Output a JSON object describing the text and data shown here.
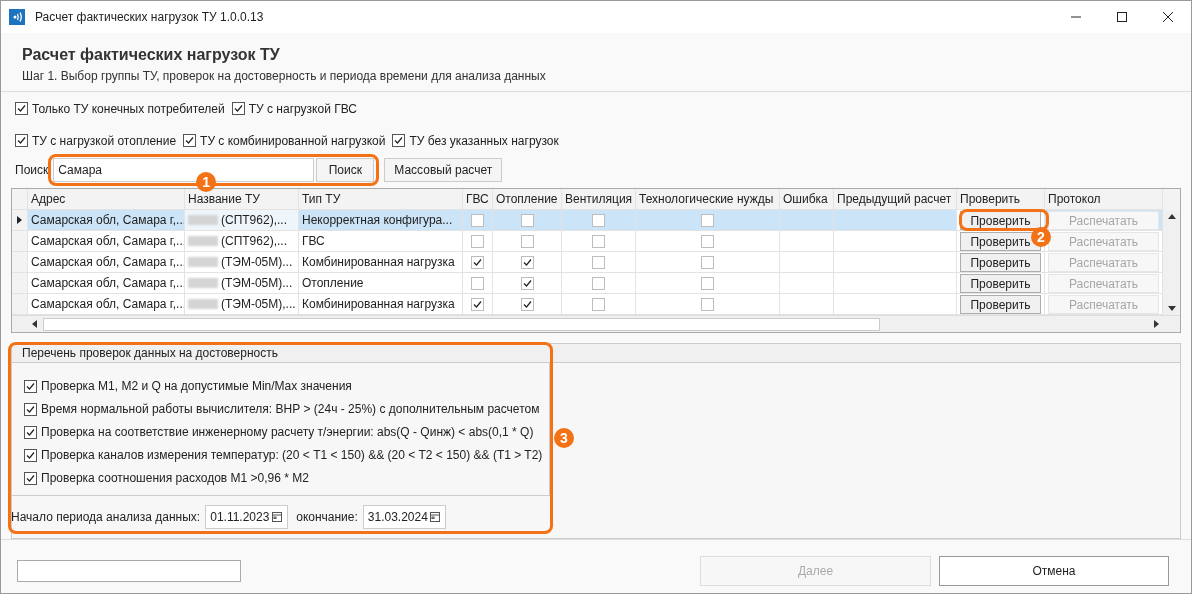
{
  "window": {
    "title": "Расчет фактических нагрузок ТУ 1.0.0.13"
  },
  "header": {
    "title": "Расчет фактических нагрузок ТУ",
    "subtitle": "Шаг 1. Выбор группы ТУ, проверок на достоверность и периода времени для анализа данных"
  },
  "filter_rows": [
    [
      {
        "label": "Только ТУ конечных потребителей",
        "checked": true
      },
      {
        "label": "ТУ с нагрузкой ГВС",
        "checked": true
      }
    ],
    [
      {
        "label": "ТУ с нагрузкой отопление",
        "checked": true
      },
      {
        "label": "ТУ с комбинированной нагрузкой",
        "checked": true
      },
      {
        "label": "ТУ без указанных нагрузок",
        "checked": true
      }
    ]
  ],
  "search": {
    "label": "Поиск",
    "value": "Самара",
    "button": "Поиск",
    "mass_button": "Массовый расчет",
    "callout": "1"
  },
  "table": {
    "columns": [
      "Адрес",
      "Название ТУ",
      "Тип ТУ",
      "ГВС",
      "Отопление",
      "Вентиляция",
      "Технологические нужды",
      "Ошибка",
      "Предыдущий расчет",
      "Проверить",
      "Протокол"
    ],
    "callout": "2",
    "rows": [
      {
        "selected": true,
        "address": "Самарская обл, Самара г,...",
        "name": "(СПТ962),...",
        "type": "Некорректная конфигура...",
        "gvs": false,
        "heating": false,
        "ventilation": false,
        "tech": false,
        "check": "Проверить",
        "print": "Распечатать",
        "print_disabled": true
      },
      {
        "selected": false,
        "address": "Самарская обл, Самара г,...",
        "name": "(СПТ962),...",
        "type": "ГВС",
        "gvs": false,
        "heating": false,
        "ventilation": false,
        "tech": false,
        "check": "Проверить",
        "print": "Распечатать",
        "print_disabled": true
      },
      {
        "selected": false,
        "address": "Самарская обл, Самара г,...",
        "name": "(ТЭМ-05М)...",
        "type": "Комбинированная нагрузка",
        "gvs": true,
        "heating": true,
        "ventilation": false,
        "tech": false,
        "check": "Проверить",
        "print": "Распечатать",
        "print_disabled": true
      },
      {
        "selected": false,
        "address": "Самарская обл, Самара г,...",
        "name": "(ТЭМ-05М)...",
        "type": "Отопление",
        "gvs": false,
        "heating": true,
        "ventilation": false,
        "tech": false,
        "check": "Проверить",
        "print": "Распечатать",
        "print_disabled": true
      },
      {
        "selected": false,
        "address": "Самарская обл, Самара г,...",
        "name": "(ТЭМ-05М),...",
        "type": "Комбинированная нагрузка",
        "gvs": true,
        "heating": true,
        "ventilation": false,
        "tech": false,
        "check": "Проверить",
        "print": "Распечатать",
        "print_disabled": true
      }
    ]
  },
  "checks_panel": {
    "title": "Перечень проверок данных на достоверность",
    "callout": "3",
    "items": [
      {
        "label": "Проверка M1, M2 и Q на допустимые Min/Max значения",
        "checked": true
      },
      {
        "label": "Время нормальной работы вычислителя: ВНР > (24ч - 25%) с дополнительным расчетом",
        "checked": true
      },
      {
        "label": "Проверка на соответствие инженерному расчету т/энергии: abs(Q - Qинж) < abs(0,1 * Q)",
        "checked": true
      },
      {
        "label": "Проверка каналов измерения температур: (20 < T1 < 150) && (20 < T2 < 150) && (T1 > T2)",
        "checked": true
      },
      {
        "label": "Проверка соотношения расходов M1 >0,96 * M2",
        "checked": true
      }
    ],
    "start_label": "Начало периода анализа данных:",
    "start_date": "01.11.2023",
    "end_label": "окончание:",
    "end_date": "31.03.2024"
  },
  "footer": {
    "next": "Далее",
    "next_disabled": true,
    "cancel": "Отмена"
  }
}
